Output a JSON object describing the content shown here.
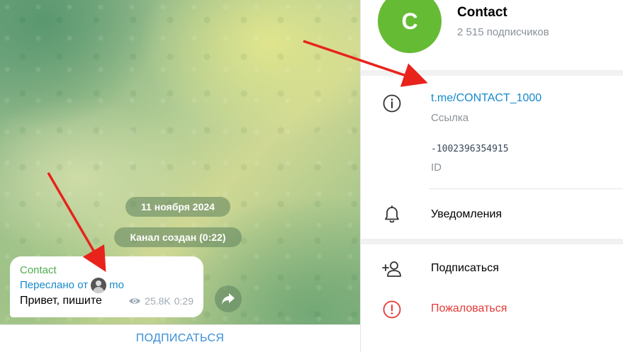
{
  "chat": {
    "date_label": "11 ноября 2024",
    "service_message": "Канал создан (0:22)",
    "message": {
      "channel_name": "Contact",
      "forwarded_prefix": "Переслано от",
      "forwarded_from": "mo",
      "text": "Привет, пишите",
      "views": "25.8K",
      "time": "0:29"
    },
    "subscribe_label": "ПОДПИСАТЬСЯ"
  },
  "profile": {
    "avatar_letter": "C",
    "avatar_color": "#66bb34",
    "name": "Contact",
    "subscribers": "2 515 подписчиков",
    "info": {
      "link": "t.me/CONTACT_1000",
      "link_label": "Ссылка",
      "id_value": "-1002396354915",
      "id_label": "ID"
    },
    "notifications_label": "Уведомления",
    "actions": {
      "subscribe": "Подписаться",
      "report": "Пожаловаться"
    }
  },
  "colors": {
    "link": "#168acd",
    "danger": "#e53935",
    "annotation_arrow": "#e8231c"
  },
  "icons": [
    "info-icon",
    "bell-icon",
    "add-user-icon",
    "alert-icon",
    "share-icon",
    "eye-icon"
  ]
}
